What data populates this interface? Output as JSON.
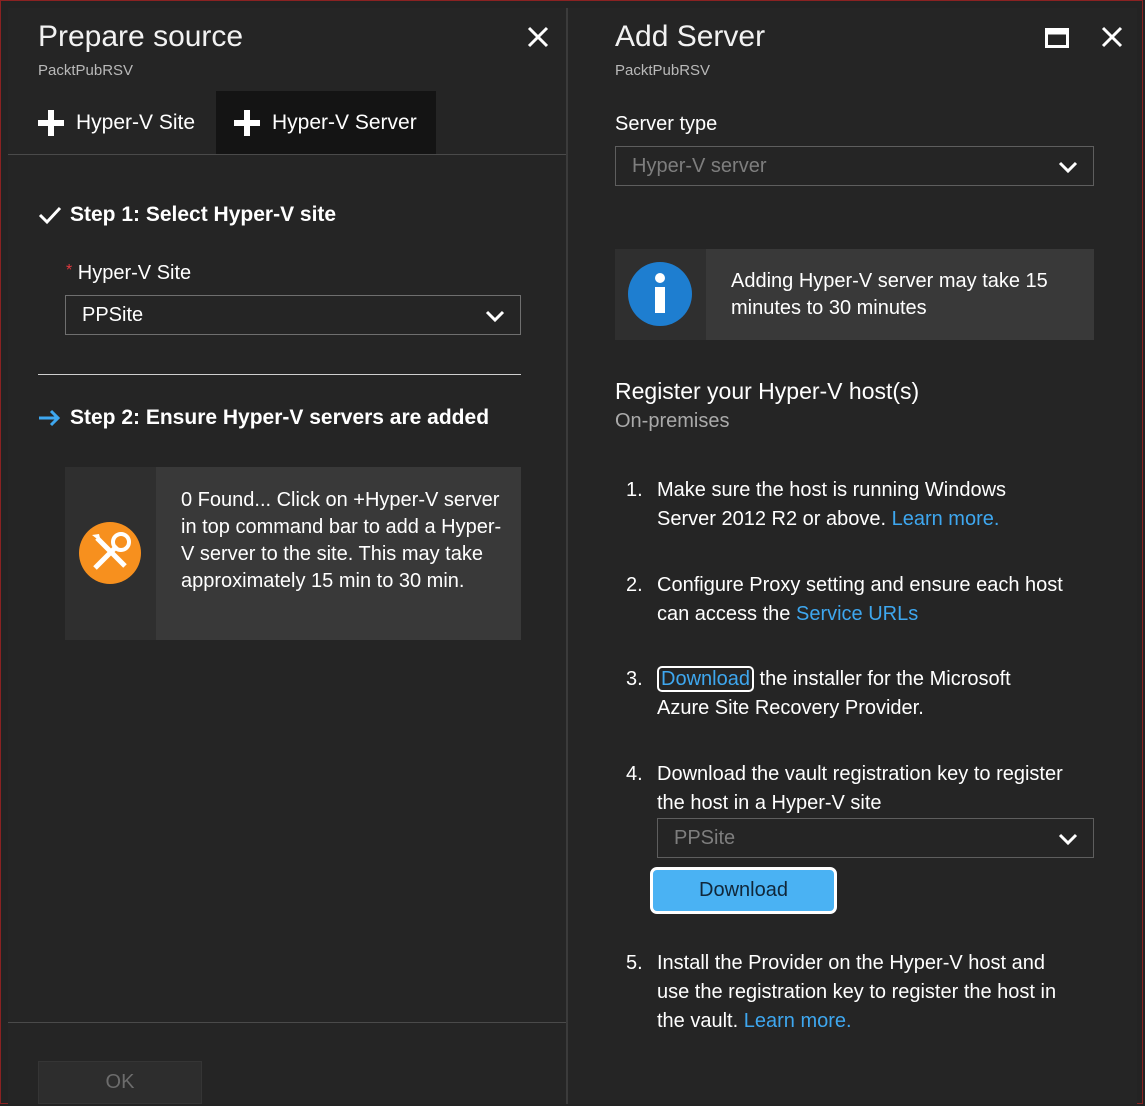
{
  "left": {
    "title": "Prepare source",
    "subtitle": "PacktPubRSV",
    "commands": [
      {
        "label": "Hyper-V Site"
      },
      {
        "label": "Hyper-V Server"
      }
    ],
    "step1": {
      "title": "Step 1: Select Hyper-V site"
    },
    "site_field": {
      "required_mark": "*",
      "label": "Hyper-V Site",
      "value": "PPSite"
    },
    "step2": {
      "title": "Step 2: Ensure Hyper-V servers are added"
    },
    "info": {
      "text": "0 Found... Click on +Hyper-V server in top command bar to add a Hyper-V server to the site. This may take approximately 15 min to 30 min."
    },
    "ok_label": "OK"
  },
  "right": {
    "title": "Add Server",
    "subtitle": "PacktPubRSV",
    "server_type": {
      "label": "Server type",
      "value": "Hyper-V server"
    },
    "info": {
      "text": "Adding Hyper-V server may take 15 minutes to 30 minutes"
    },
    "register": {
      "title": "Register your Hyper-V host(s)",
      "subtitle": "On-premises"
    },
    "steps": [
      {
        "num": "1.",
        "text": "Make sure the host is running Windows Server 2012 R2 or above.",
        "link": "Learn more."
      },
      {
        "num": "2.",
        "text": "Configure Proxy setting and ensure each host can access the",
        "link": "Service URLs"
      },
      {
        "num": "3.",
        "link": "Download",
        "text": "the installer for the Microsoft Azure Site Recovery Provider."
      },
      {
        "num": "4.",
        "text": "Download the vault registration key to register the host in a Hyper-V site"
      },
      {
        "num": "5.",
        "text": "Install the Provider on the Hyper-V host and use the registration key to register the host in the vault.",
        "link": "Learn more."
      }
    ],
    "site_select_value": "PPSite",
    "download_button": "Download"
  },
  "colors": {
    "accent": "#3ea7ef",
    "background": "#252525",
    "warning_icon": "#f7901e",
    "info_icon": "#1e7ed0"
  }
}
